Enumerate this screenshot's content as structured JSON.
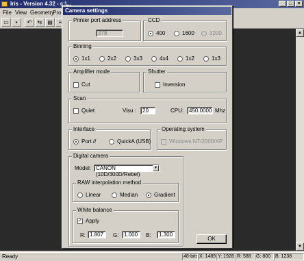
{
  "app": {
    "title": "Iris - Version 4.32 - c:\\...",
    "menu": [
      "File",
      "View",
      "Geometry",
      "Pro"
    ],
    "toolbar_icons": [
      "folder-open-icon",
      "save-icon",
      "undo-icon",
      "redo-icon",
      "layers-icon",
      "align-left-icon",
      "align-center-icon",
      "pointer-icon",
      "measure-icon",
      "text-icon"
    ],
    "status": {
      "ready": "Ready",
      "bits": "48-bits",
      "x": "X: 1489",
      "y": "Y: 1928",
      "r": "R: 588",
      "g": "G: 800",
      "b": "B: 1238"
    }
  },
  "dialog": {
    "title": "Camera settings",
    "printer_port": {
      "legend": "Printer port address",
      "value": "378"
    },
    "ccd": {
      "legend": "CCD",
      "options": [
        "400",
        "1600",
        "3200"
      ],
      "selected": "400"
    },
    "binning": {
      "legend": "Binning",
      "options": [
        "1x1",
        "2x2",
        "3x3",
        "4x4",
        "1x2",
        "1x3"
      ],
      "selected": "1x1"
    },
    "amplifier": {
      "legend": "Amplifier mode",
      "cut_label": "Cut",
      "cut_checked": false
    },
    "shutter": {
      "legend": "Shutter",
      "inversion_label": "Inversion",
      "inversion_checked": false
    },
    "scan": {
      "legend": "Scan",
      "quiet_label": "Quiet",
      "quiet_checked": false,
      "visu_label": "Visu :",
      "visu_value": "20",
      "cpu_label": "CPU:",
      "cpu_value": "450.0000",
      "cpu_unit": "Mhz"
    },
    "interface": {
      "legend": "Interface",
      "options": [
        "Port //",
        "QuickA (USB)"
      ],
      "selected": "Port //"
    },
    "os": {
      "legend": "Operating system",
      "option_label": "Windows NT/2000/XP",
      "checked": false
    },
    "digital_camera": {
      "legend": "Digital camera",
      "model_label": "Model:",
      "model_value": "CANON (10D/300D/Rebel)",
      "raw": {
        "legend": "RAW interpolation method",
        "options": [
          "Linear",
          "Median",
          "Gradient"
        ],
        "selected": "Gradient"
      },
      "white_balance": {
        "legend": "White balance",
        "apply_label": "Apply",
        "apply_checked": true,
        "r_label": "R:",
        "r_value": "1.807",
        "g_label": "G:",
        "g_value": "1.000",
        "b_label": "B:",
        "b_value": "1.300"
      }
    },
    "ok_label": "OK"
  }
}
